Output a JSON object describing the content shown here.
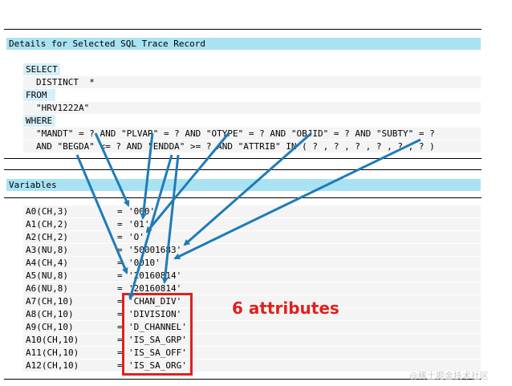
{
  "details": {
    "title": "Details for Selected SQL Trace Record",
    "sql": {
      "select_kw": "SELECT",
      "select_fields": "DISTINCT  *",
      "from_kw": "FROM",
      "table": "\"HRV1222A\"",
      "where_kw": "WHERE",
      "cond_line1": "\"MANDT\" = ? AND \"PLVAR\" = ? AND \"OTYPE\" = ? AND \"OBJID\" = ? AND \"SUBTY\" = ?",
      "cond_line2": "AND \"BEGDA\" <= ? AND \"ENDDA\" >= ? AND \"ATTRIB\" IN ( ? , ? , ? , ? , ? , ? )"
    }
  },
  "variables": {
    "title": "Variables",
    "rows": [
      {
        "name": "A0(CH,3)",
        "eq": "=",
        "value": "'000'"
      },
      {
        "name": "A1(CH,2)",
        "eq": "=",
        "value": "'01'"
      },
      {
        "name": "A2(CH,2)",
        "eq": "=",
        "value": "'O'"
      },
      {
        "name": "A3(NU,8)",
        "eq": "=",
        "value": "'50001683'"
      },
      {
        "name": "A4(CH,4)",
        "eq": "=",
        "value": "'0010'"
      },
      {
        "name": "A5(NU,8)",
        "eq": "=",
        "value": "'20160814'"
      },
      {
        "name": "A6(NU,8)",
        "eq": "=",
        "value": "'20160814'"
      },
      {
        "name": "A7(CH,10)",
        "eq": "=",
        "value": "'CHAN_DIV'"
      },
      {
        "name": "A8(CH,10)",
        "eq": "=",
        "value": "'DIVISION'"
      },
      {
        "name": "A9(CH,10)",
        "eq": "=",
        "value": "'D_CHANNEL'"
      },
      {
        "name": "A10(CH,10)",
        "eq": "=",
        "value": "'IS_SA_GRP'"
      },
      {
        "name": "A11(CH,10)",
        "eq": "=",
        "value": "'IS_SA_OFF'"
      },
      {
        "name": "A12(CH,10)",
        "eq": "=",
        "value": "'IS_SA_ORG'"
      }
    ]
  },
  "annotation": {
    "note": "6 attributes",
    "highlight_color": "#e0201d",
    "arrow_color": "#1f7bb8"
  },
  "watermark": "@稀土掘金技术社区"
}
